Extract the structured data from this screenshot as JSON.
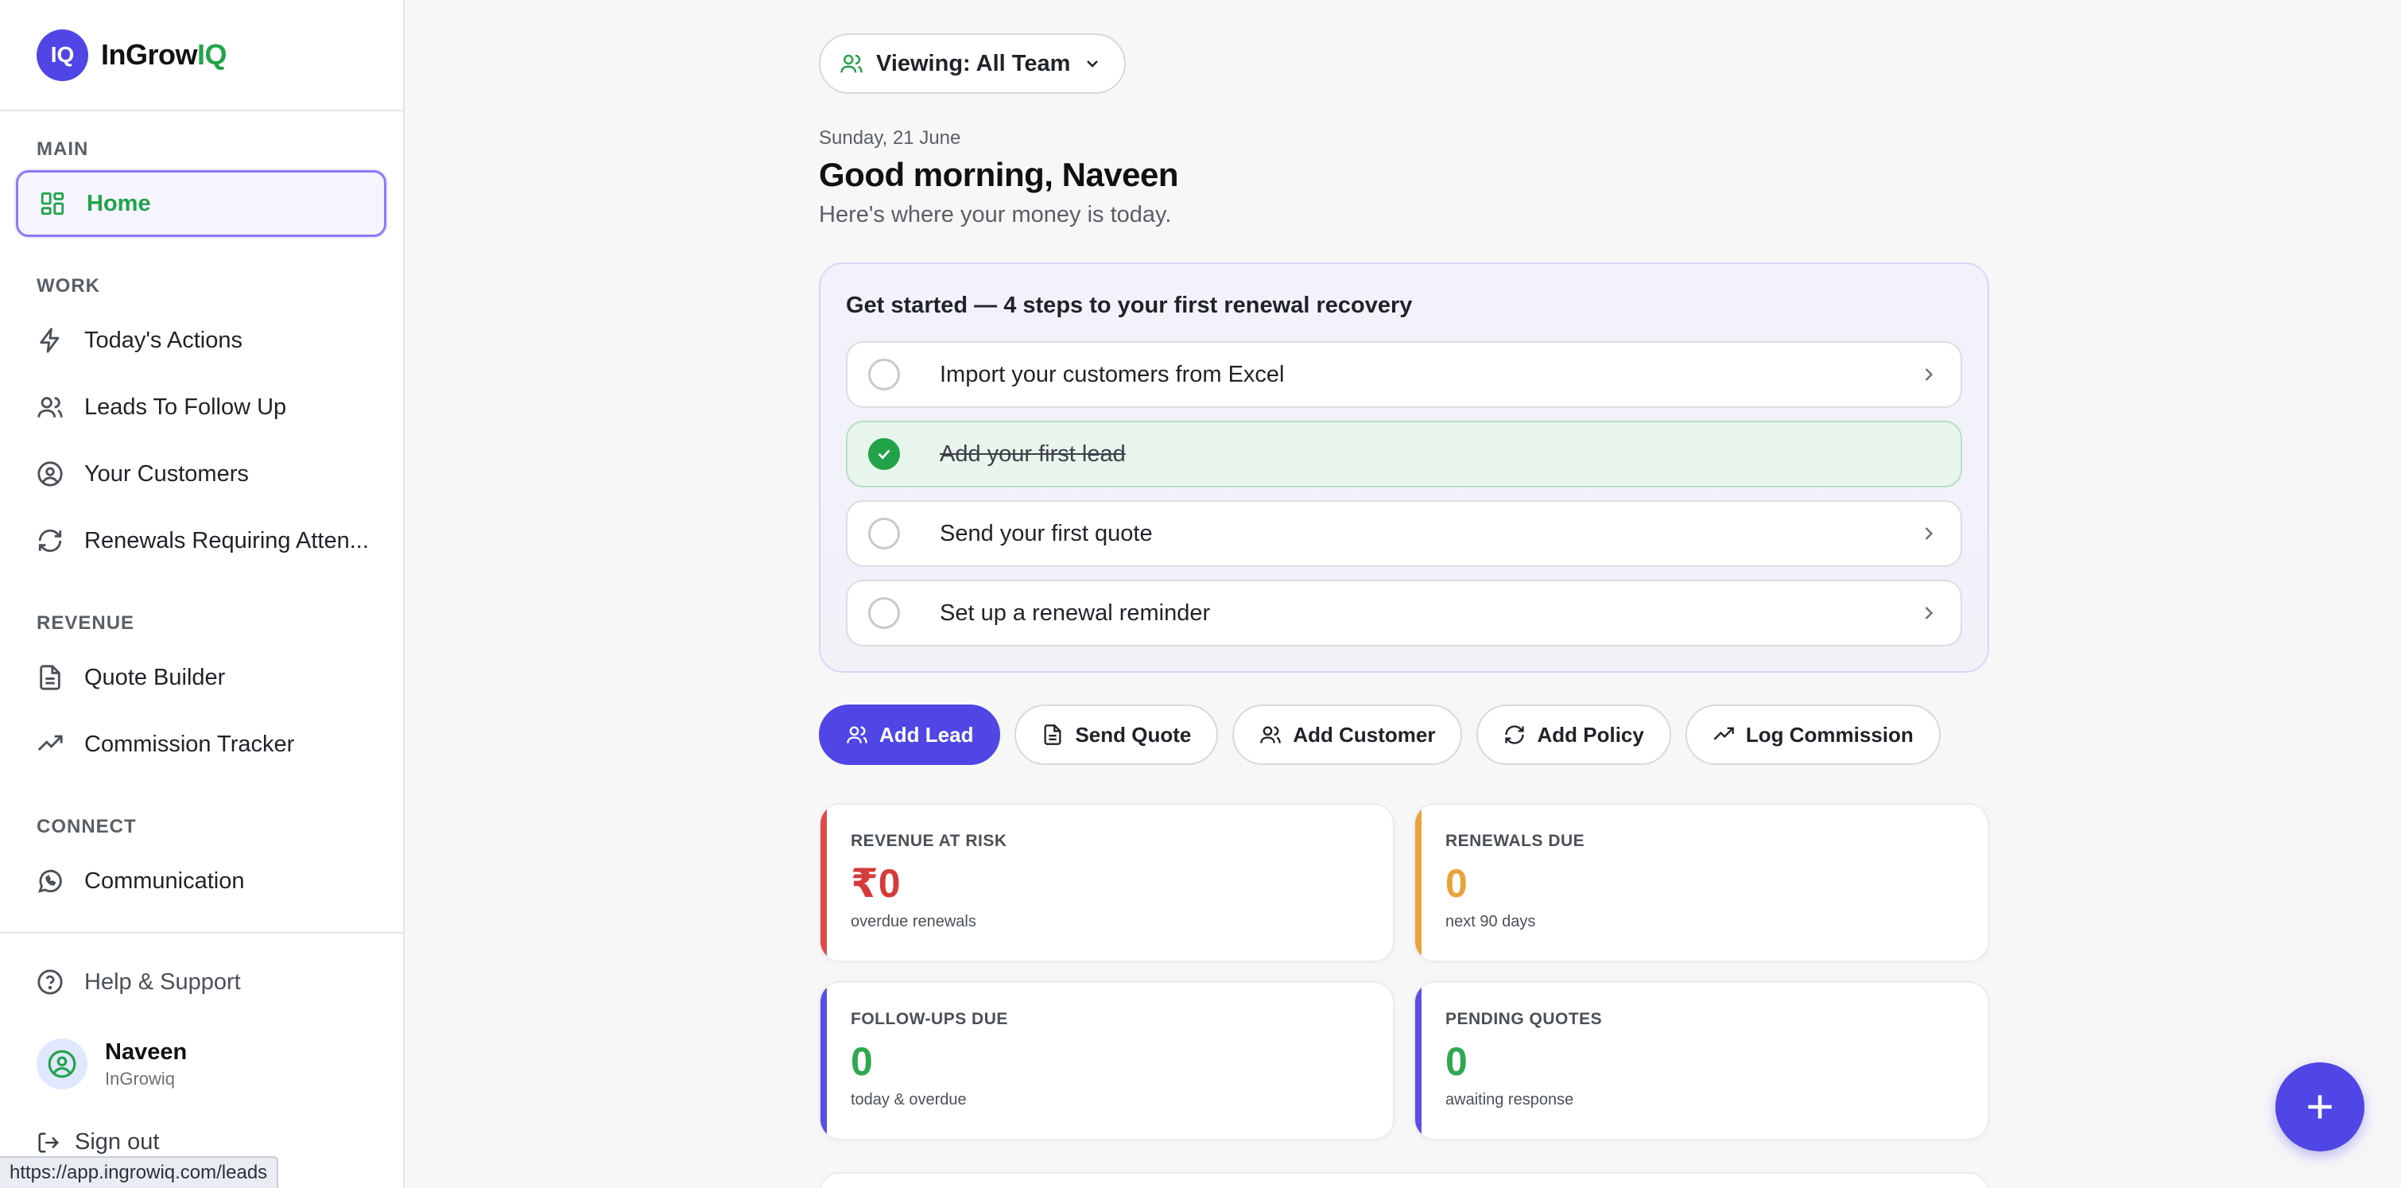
{
  "brand": {
    "logo_initials": "IQ",
    "name_main": "InGrow",
    "name_accent": "IQ",
    "accent_color": "#22a34a",
    "logo_color": "#4f46e5"
  },
  "sidebar": {
    "sections": [
      {
        "title": "MAIN",
        "items": [
          {
            "label": "Home",
            "icon": "grid-icon",
            "active": true
          }
        ]
      },
      {
        "title": "WORK",
        "items": [
          {
            "label": "Today's Actions",
            "icon": "lightning-icon"
          },
          {
            "label": "Leads To Follow Up",
            "icon": "users-icon"
          },
          {
            "label": "Your Customers",
            "icon": "user-circle-icon"
          },
          {
            "label": "Renewals Requiring Atten...",
            "icon": "refresh-icon"
          }
        ]
      },
      {
        "title": "REVENUE",
        "items": [
          {
            "label": "Quote Builder",
            "icon": "document-icon"
          },
          {
            "label": "Commission Tracker",
            "icon": "trending-up-icon"
          }
        ]
      },
      {
        "title": "CONNECT",
        "items": [
          {
            "label": "Communication",
            "icon": "whatsapp-icon"
          }
        ]
      }
    ],
    "help_label": "Help & Support",
    "user": {
      "name": "Naveen",
      "org": "InGrowiq"
    },
    "signout_label": "Sign out"
  },
  "status_bar_url": "https://app.ingrowiq.com/leads",
  "header": {
    "team_selector": "Viewing: All Team",
    "date": "Sunday, 21 June",
    "greeting": "Good morning, Naveen",
    "tagline": "Here's where your money is today."
  },
  "get_started": {
    "title": "Get started — 4 steps to your first renewal recovery",
    "steps": [
      {
        "label": "Import your customers from Excel",
        "done": false
      },
      {
        "label": "Add your first lead",
        "done": true
      },
      {
        "label": "Send your first quote",
        "done": false
      },
      {
        "label": "Set up a renewal reminder",
        "done": false
      }
    ]
  },
  "quick_actions": [
    {
      "label": "Add Lead",
      "icon": "users-icon",
      "primary": true
    },
    {
      "label": "Send Quote",
      "icon": "document-icon"
    },
    {
      "label": "Add Customer",
      "icon": "users-icon"
    },
    {
      "label": "Add Policy",
      "icon": "refresh-icon"
    },
    {
      "label": "Log Commission",
      "icon": "trending-up-icon"
    }
  ],
  "stats": [
    {
      "title": "REVENUE AT RISK",
      "value": "₹0",
      "sub": "overdue renewals",
      "accent": "#e04848",
      "value_color": "#d63a3a"
    },
    {
      "title": "RENEWALS DUE",
      "value": "0",
      "sub": "next 90 days",
      "accent": "#e8a33d",
      "value_color": "#e8a33d"
    },
    {
      "title": "FOLLOW-UPS DUE",
      "value": "0",
      "sub": "today & overdue",
      "accent": "#5b4ee6",
      "value_color": "#2fa84f"
    },
    {
      "title": "PENDING QUOTES",
      "value": "0",
      "sub": "awaiting response",
      "accent": "#5b4ee6",
      "value_color": "#2fa84f"
    }
  ],
  "fab_icon": "plus-icon"
}
